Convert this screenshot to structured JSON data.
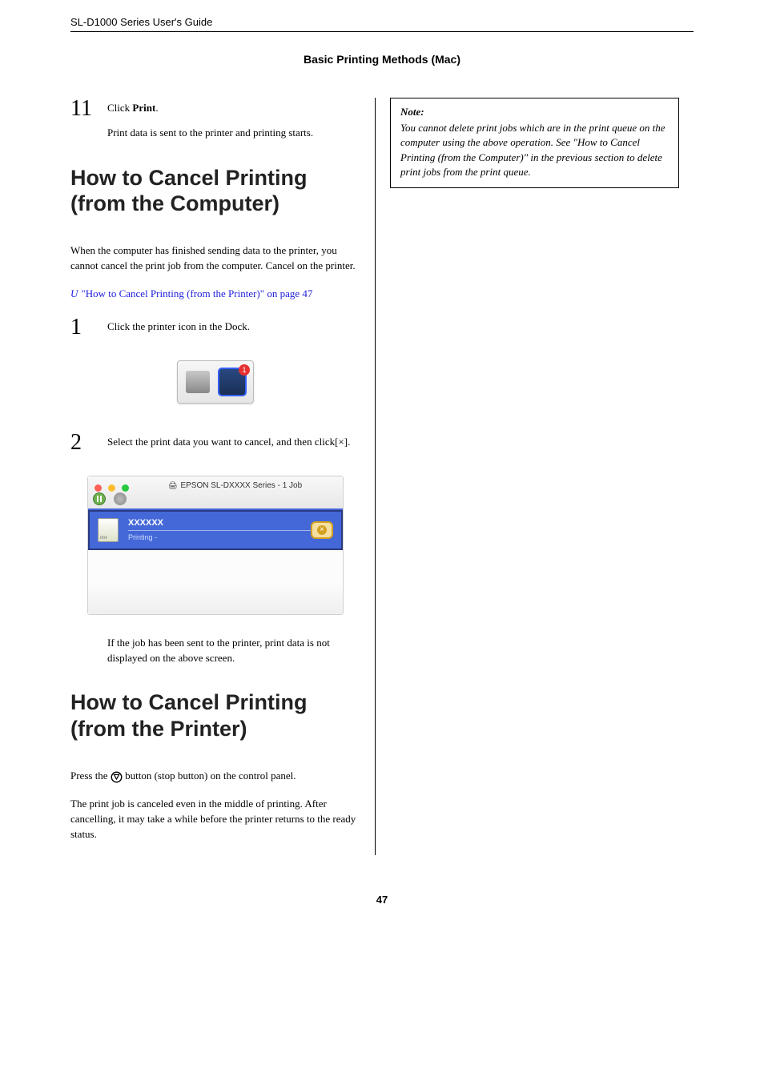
{
  "header": {
    "guide": "SL-D1000 Series User's Guide",
    "section": "Basic Printing Methods (Mac)"
  },
  "step11": {
    "num": "11",
    "line1_prefix": "Click ",
    "line1_bold": "Print",
    "line1_suffix": ".",
    "line2": "Print data is sent to the printer and printing starts."
  },
  "heading_cancel_computer": "How to Cancel Printing (from the Computer)",
  "para_finish": "When the computer has finished sending data to the printer, you cannot cancel the print job from the computer. Cancel on the printer.",
  "xref": {
    "icon": "U",
    "text": "\"How to Cancel Printing (from the Printer)\" on page 47"
  },
  "step1": {
    "num": "1",
    "text": "Click the printer icon in the Dock."
  },
  "dock": {
    "badge": "1"
  },
  "step2": {
    "num": "2",
    "text": "Select the print data you want to cancel, and then click[×]."
  },
  "queue": {
    "title": "EPSON SL-DXXXX Series - 1 Job",
    "job_name": "XXXXXX",
    "job_status": "Printing -",
    "close_glyph": "×"
  },
  "step2_after": "If the job has been sent to the printer, print data is not displayed on the above screen.",
  "heading_cancel_printer": "How to Cancel Printing (from the Printer)",
  "para_press_prefix": "Press the ",
  "para_press_suffix": " button (stop button) on the control panel.",
  "para_cancel_middle": "The print job is canceled even in the middle of printing. After cancelling, it may take a while before the printer returns to the ready status.",
  "note": {
    "title": "Note:",
    "body": "You cannot delete print jobs which are in the print queue on the computer using the above operation. See \"How to Cancel Printing (from the Computer)\" in the previous section to delete print jobs from the print queue."
  },
  "page_number": "47"
}
